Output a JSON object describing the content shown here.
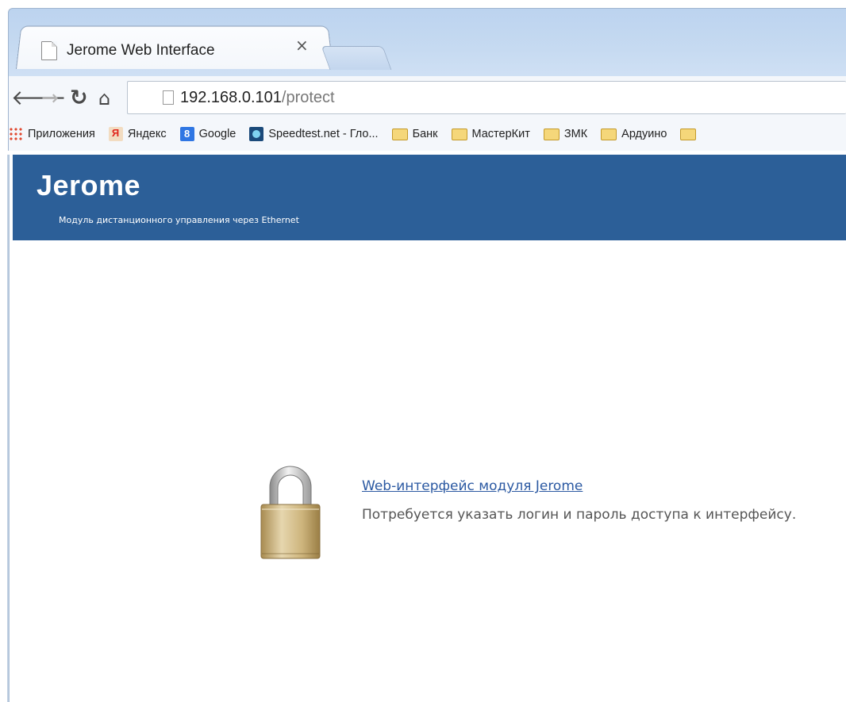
{
  "browser": {
    "tab_title": "Jerome Web Interface",
    "tab_close": "×",
    "url_host": "192.168.0.101",
    "url_path": "/protect",
    "bookmarks": [
      {
        "label": "Приложения",
        "icon": "apps-grid-icon"
      },
      {
        "label": "Яндекс",
        "icon": "yandex-icon"
      },
      {
        "label": "Google",
        "icon": "google-icon"
      },
      {
        "label": "Speedtest.net - Гло...",
        "icon": "speedtest-icon"
      },
      {
        "label": "Банк",
        "icon": "folder-icon"
      },
      {
        "label": "МастерКит",
        "icon": "folder-icon"
      },
      {
        "label": "ЗМК",
        "icon": "folder-icon"
      },
      {
        "label": "Ардуино",
        "icon": "folder-icon"
      }
    ]
  },
  "header": {
    "title": "Jerome",
    "subtitle": "Модуль дистанционного управления через Ethernet",
    "background": "#2c5f98"
  },
  "main": {
    "link_text": "Web-интерфейс модуля Jerome",
    "description": "Потребуется указать логин и пароль доступа к интерфейсу."
  }
}
